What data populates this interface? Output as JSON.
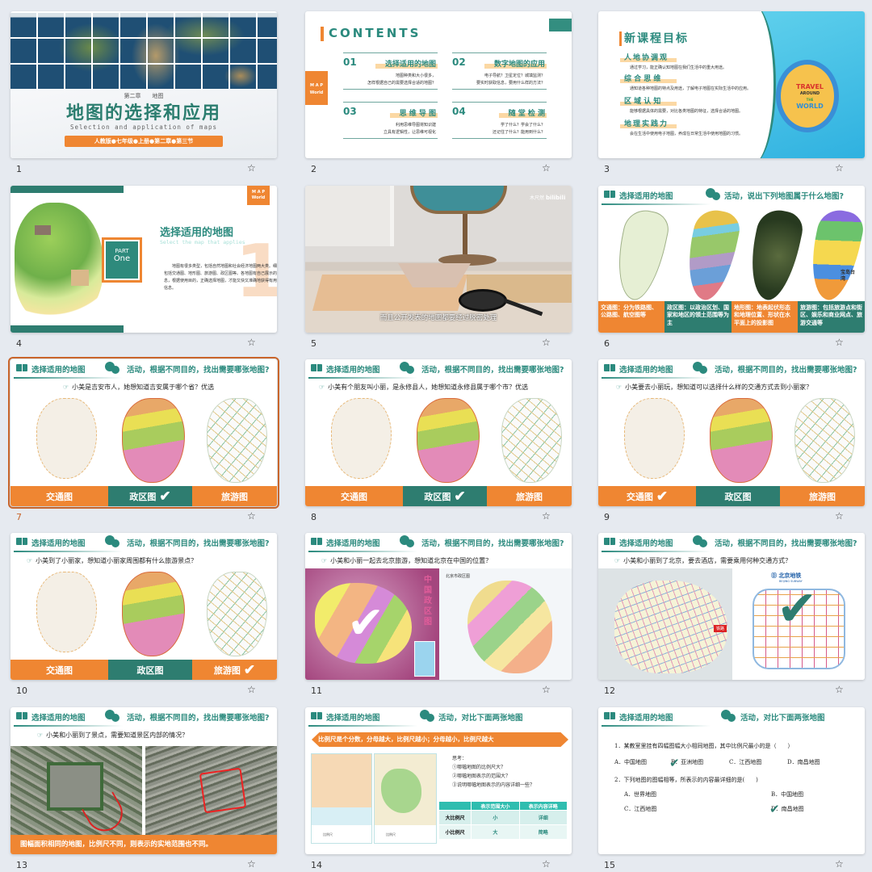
{
  "colors": {
    "accent_teal": "#2b8a7e",
    "accent_orange": "#ef8632",
    "dark_teal": "#2e7d70",
    "selected_border": "#c9652b",
    "background": "#e6eaf0"
  },
  "star_icon": "star-outline-icon",
  "selected_slide": "7",
  "common": {
    "section_title": "选择适用的地图",
    "activity_find": "活动，根据不同目的，找出需要哪张地图?",
    "map_labels": [
      "交通图",
      "政区图",
      "旅游图"
    ],
    "check": "✔"
  },
  "slides": [
    {
      "number": "1",
      "chapter": "第二章　　地图",
      "title": "地图的选择和应用",
      "subtitle": "Selection and application of maps",
      "badge": "人教版●七年级●上册●第二章●第三节"
    },
    {
      "number": "2",
      "title": "CONTENTS",
      "side_badge": [
        "M A P",
        "World"
      ],
      "items": [
        {
          "no": "01",
          "title": "选择适用的地图",
          "desc": [
            "地图种类和大小很多，",
            "怎样根据自己的需要选择合适的地图？"
          ]
        },
        {
          "no": "02",
          "title": "数字地图的应用",
          "desc": [
            "电子导航？卫星定位？城填监测？",
            "要实时获取信息，要用什么样的方法？"
          ]
        },
        {
          "no": "03",
          "title": "思 维 导 图",
          "desc": [
            "利用思维导图将知识建",
            "立具有逻辑性，让思维可视化"
          ]
        },
        {
          "no": "04",
          "title": "随 堂 检 测",
          "desc": [
            "学了什么？学会了什么？",
            "还记住了什么？能用到什么？"
          ]
        }
      ]
    },
    {
      "number": "3",
      "title": "新课程目标",
      "image_text": [
        "TRAVEL",
        "AROUND",
        "THE",
        "WORLD"
      ],
      "goals": [
        {
          "title": "人地协调观",
          "desc": "通过学习，能正确认知地图在我们生活中的重大用途。"
        },
        {
          "title": "综 合 思 维",
          "desc": "通知道各种地图的特点及用途，了解电子地图在实际生活中的应用。"
        },
        {
          "title": "区 域 认 知",
          "desc": "能够根据具体的需要，对比各类地图的特征，选择合适的地图。"
        },
        {
          "title": "地理实践力",
          "desc": "会在生活中使用电子地图，养成在日常生活中使用地图的习惯。"
        }
      ]
    },
    {
      "number": "4",
      "part": "PART",
      "part_no": "One",
      "title": "选择适用的地图",
      "subtitle": "Select the map that applies",
      "big_number": "1",
      "badge": [
        "M A P",
        "World"
      ],
      "desc": "地图有很多类型，包括自然地图和社会经济地图两大类。细分包括交通图、地形图、旅游图、政区图等。各地图有自己展示的信息，根据使用目的，正确选择地图，才能又快又准确地获得有用的信息。"
    },
    {
      "number": "5",
      "watermark": "木尺然",
      "watermark_logo": "bilibili",
      "subtitle": "而且公开发表的地图都要经过脱密处理"
    },
    {
      "number": "6",
      "activity": "活动，说出下列地图属于什么地图?",
      "map_badge": "宝岛台湾",
      "captions": [
        "交通图：分为铁路图、公路图、航空图等",
        "政区图：以政治区划、国家和地区的领土范围等为主",
        "地形图：地表起伏形态和地理位置、形状在水平面上的投影图",
        "旅游图：包括旅游点和街区、娱乐和商业网点、旅游交通等"
      ]
    },
    {
      "number": "7",
      "question": "小美是吉安市人，她想知道吉安属于哪个省？优选",
      "checked": "政区图"
    },
    {
      "number": "8",
      "question": "小美有个朋友叫小丽，是永修县人，她想知道永修县属于哪个市？优选",
      "checked": "政区图"
    },
    {
      "number": "9",
      "question": "小美要去小丽玩，想知道可以选择什么样的交通方式去到小丽家？",
      "checked": "交通图"
    },
    {
      "number": "10",
      "question": "小美到了小丽家，想知道小丽家周围都有什么旅游景点？",
      "checked": "旅游图"
    },
    {
      "number": "11",
      "question": "小美和小丽一起去北京旅游，想知道北京在中国的位置？",
      "left_map_title": "中国政区图",
      "right_map_title": "北京市政区图"
    },
    {
      "number": "12",
      "question": "小美和小丽到了北京，要去酒店，需要乘用何种交通方式？",
      "subway_title": "北京地铁",
      "subway_subtitle": "BEIJING SUBWAY",
      "tag": "铁路"
    },
    {
      "number": "13",
      "question": "小美和小丽到了景点，需要知道景区内部的情况？",
      "footer": "图幅面积相同的地图，比例尺不同，则表示的实地范围也不同。"
    },
    {
      "number": "14",
      "activity": "活动，对比下面两张地图",
      "banner": "比例尺是个分数，分母越大，比例尺越小；分母越小，比例尺越大",
      "scale_label": "比例尺",
      "think_title": "思考：",
      "think": [
        "①哪幅地图的比例尺大？",
        "②哪幅地图表示的范围大？",
        "③说明哪幅地图表示的内容详细一些？"
      ],
      "table": {
        "headers": [
          "",
          "表示范围大小",
          "表示内容详略"
        ],
        "rows": [
          [
            "大比例尺",
            "小",
            "详细"
          ],
          [
            "小比例尺",
            "大",
            "简略"
          ]
        ]
      }
    },
    {
      "number": "15",
      "activity": "活动，对比下面两张地图",
      "q1": "1．某教室里挂有四幅图幅大小相同地图，其中比例尺最小的是（　　）",
      "q1_options": [
        "A．中国地图",
        "B．亚洲地图",
        "C．江西地图",
        "D．南昌地图"
      ],
      "q2": "2．下列地图的图幅相等，所表示的内容最详细的是(　　)",
      "q2_options": [
        "A．世界地图",
        "B．中国地图",
        "C．江西地图",
        "D．南昌地图"
      ]
    }
  ]
}
